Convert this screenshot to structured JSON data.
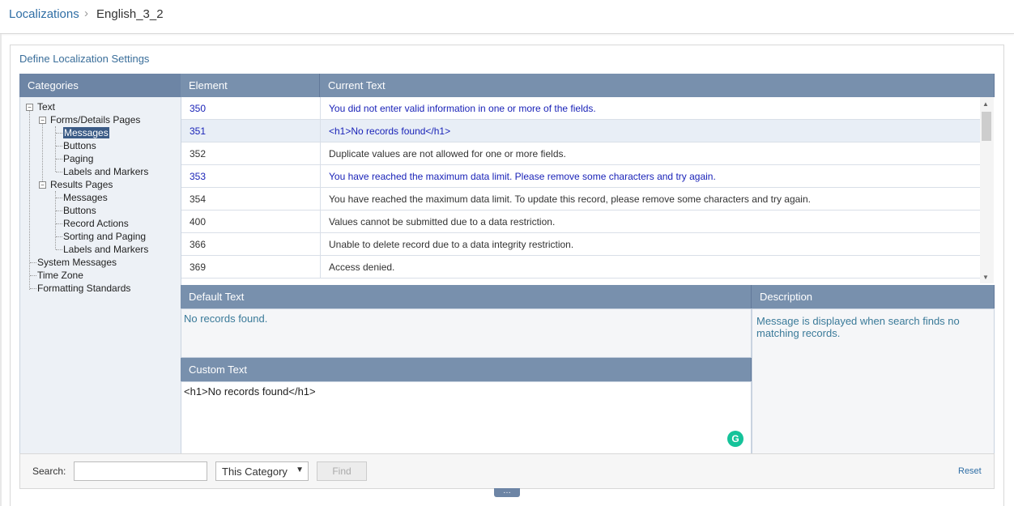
{
  "breadcrumb": {
    "root": "Localizations",
    "current": "English_3_2"
  },
  "panel_title": "Define Localization Settings",
  "headers": {
    "categories": "Categories",
    "element": "Element",
    "current_text": "Current Text",
    "default_text": "Default Text",
    "description": "Description",
    "custom_text": "Custom Text"
  },
  "tree": {
    "text": "Text",
    "forms": "Forms/Details Pages",
    "forms_items": [
      "Messages",
      "Buttons",
      "Paging",
      "Labels and Markers"
    ],
    "results": "Results Pages",
    "results_items": [
      "Messages",
      "Buttons",
      "Record Actions",
      "Sorting and Paging",
      "Labels and Markers"
    ],
    "system_messages": "System Messages",
    "time_zone": "Time Zone",
    "formatting": "Formatting Standards"
  },
  "rows": [
    {
      "element": "350",
      "text": "You did not enter valid information in one or more of the fields."
    },
    {
      "element": "351",
      "text": "<h1>No records found</h1>"
    },
    {
      "element": "352",
      "text": "Duplicate values are not allowed for one or more fields."
    },
    {
      "element": "353",
      "text": "You have reached the maximum data limit. Please remove some characters and try again."
    },
    {
      "element": "354",
      "text": "You have reached the maximum data limit. To update this record, please remove some characters and try again."
    },
    {
      "element": "400",
      "text": "Values cannot be submitted due to a data restriction."
    },
    {
      "element": "366",
      "text": "Unable to delete record due to a data integrity restriction."
    },
    {
      "element": "369",
      "text": "Access denied."
    }
  ],
  "default_text_value": "No records found.",
  "description_value": "Message is displayed when search finds no matching records.",
  "custom_text_value": "<h1>No records found</h1>",
  "footer": {
    "search_label": "Search:",
    "search_value": "",
    "scope": "This Category",
    "find": "Find",
    "reset": "Reset"
  },
  "colors": {
    "header_bg": "#7890ad",
    "link": "#2f6ea5",
    "modified_text": "#1a23b8"
  }
}
